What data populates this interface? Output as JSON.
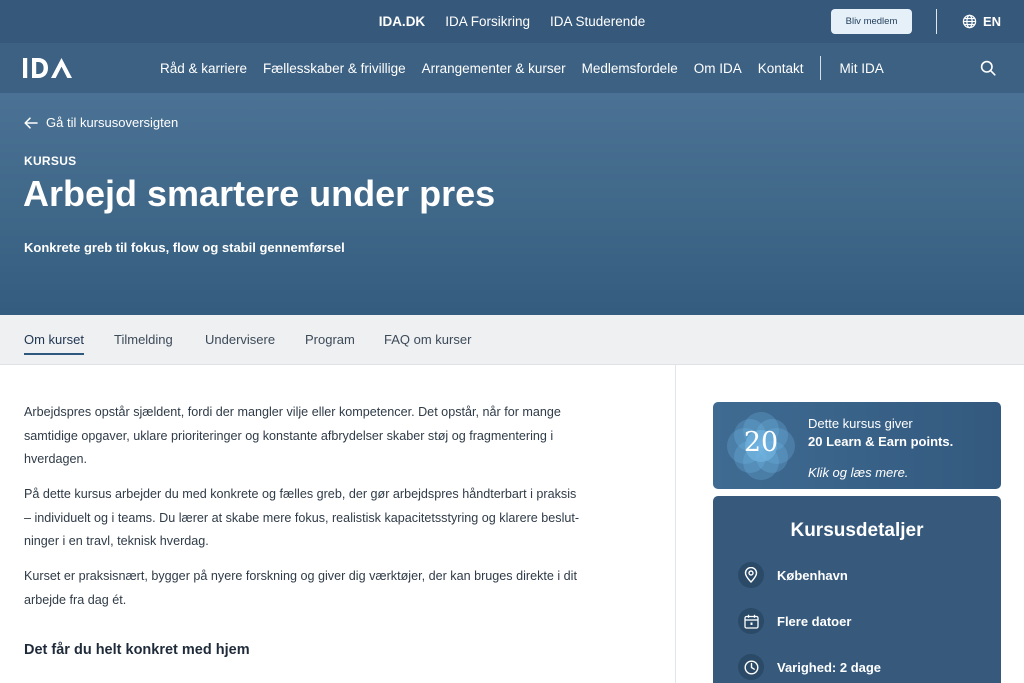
{
  "topbar": {
    "sites": [
      "IDA.DK",
      "IDA Forsikring",
      "IDA Studerende"
    ],
    "join_label": "Bliv medlem",
    "lang_label": "EN",
    "lang_icon": "globe-icon"
  },
  "nav": {
    "logo_alt": "IDA",
    "items": [
      "Råd & karriere",
      "Fællesskaber & frivillige",
      "Arrangementer & kurser",
      "Medlemsfordele",
      "Om IDA",
      "Kontakt"
    ],
    "account": "Mit IDA",
    "search_icon": "search-icon"
  },
  "hero": {
    "back_label": "Gå til kursusoversigten",
    "kicker": "KURSUS",
    "title": "Arbejd smartere under pres",
    "subtitle": "Konkrete greb til fokus, flow og stabil gennemførsel"
  },
  "tabs": {
    "items": [
      "Om kurset",
      "Tilmelding",
      "Undervisere",
      "Program",
      "FAQ om kurser"
    ],
    "active": "Om kurset"
  },
  "content": {
    "p1_lines": [
      "Arbejdspres opstår sjældent, fordi der mangler vilje eller kompetencer. Det opstår, når for mange",
      "samtidige opgaver, uklare prioriteringer og konstante afbrydelser skaber støj og fragmentering i",
      "hverdagen."
    ],
    "p2_lines": [
      "På dette kursus arbejder du med konkrete og fælles greb, der gør arbejdspres håndterbart i praksis",
      "– individuelt og i teams. Du lærer at skabe mere fokus, realistisk kapacitetsstyring og klarere beslut-",
      "ninger i en travl, teknisk hverdag."
    ],
    "p3_lines": [
      "Kurset er praksisnært, bygger på nyere forskning og giver dig værktøjer, der kan bruges direkte i dit",
      "arbejde fra dag ét."
    ],
    "section_heading": "Det får du helt konkret med hjem"
  },
  "points": {
    "value": "20",
    "line1": "Dette kursus giver",
    "line2": "20 Learn & Earn points.",
    "line3": "Klik og læs mere."
  },
  "details": {
    "title": "Kursusdetaljer",
    "rows": [
      {
        "icon": "location-pin-icon",
        "text": "København"
      },
      {
        "icon": "calendar-icon",
        "text": "Flere datoer"
      },
      {
        "icon": "clock-icon",
        "text": "Varighed: 2 dage"
      }
    ]
  },
  "colors": {
    "topbar": "#36597b",
    "nav": "#3c6183",
    "hero": "#426a8c",
    "accent": "#2e587e",
    "card": "#36597c"
  }
}
